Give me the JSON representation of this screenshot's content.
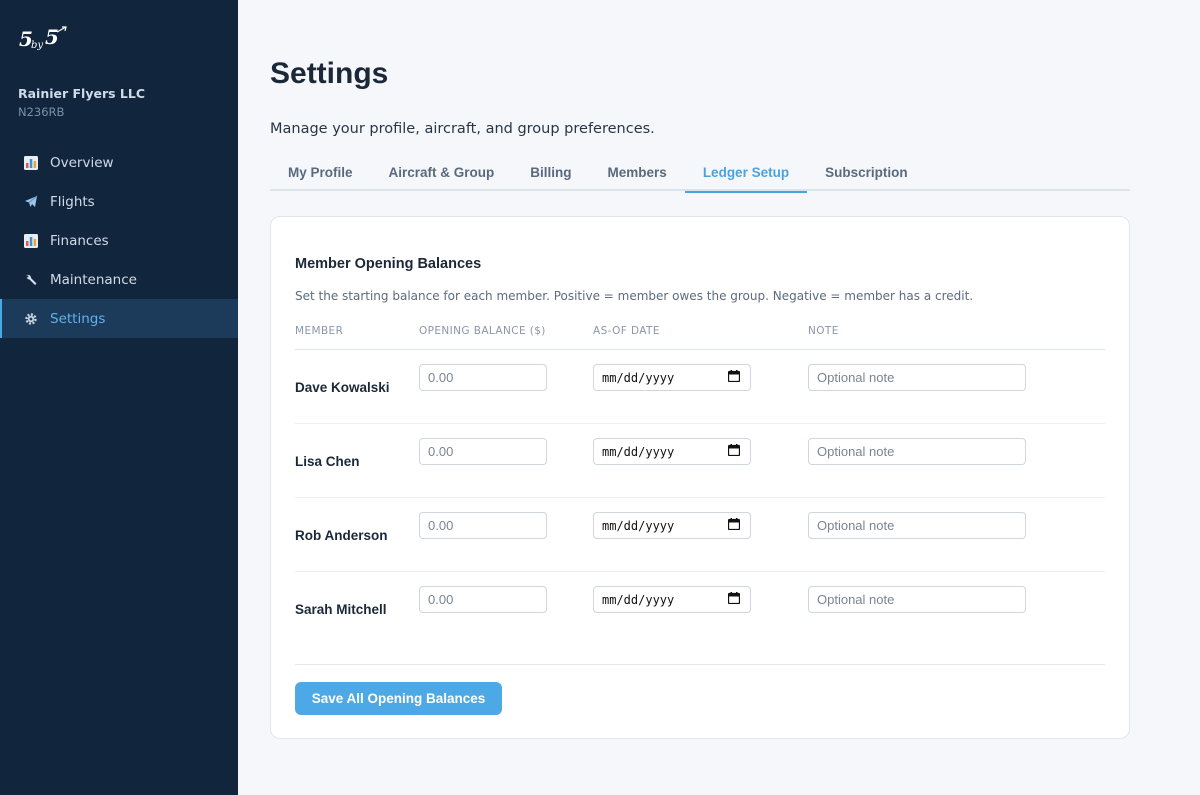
{
  "sidebar": {
    "logo_text": "5by5",
    "org_name": "Rainier Flyers LLC",
    "tail_number": "N236RB",
    "items": [
      {
        "label": "Overview",
        "icon": "bar-chart-icon"
      },
      {
        "label": "Flights",
        "icon": "airplane-icon"
      },
      {
        "label": "Finances",
        "icon": "bar-chart-icon"
      },
      {
        "label": "Maintenance",
        "icon": "wrench-icon"
      },
      {
        "label": "Settings",
        "icon": "gear-icon",
        "active": true
      }
    ]
  },
  "header": {
    "title": "Settings",
    "subtitle": "Manage your profile, aircraft, and group preferences."
  },
  "tabs": [
    {
      "label": "My Profile"
    },
    {
      "label": "Aircraft & Group"
    },
    {
      "label": "Billing"
    },
    {
      "label": "Members"
    },
    {
      "label": "Ledger Setup",
      "active": true
    },
    {
      "label": "Subscription"
    }
  ],
  "card": {
    "title": "Member Opening Balances",
    "description": "Set the starting balance for each member. Positive = member owes the group. Negative = member has a credit.",
    "columns": [
      "MEMBER",
      "OPENING BALANCE ($)",
      "AS-OF DATE",
      "NOTE"
    ],
    "rows": [
      {
        "member": "Dave Kowalski",
        "balance_placeholder": "0.00",
        "date_placeholder": "mm/dd/yyyy",
        "note_placeholder": "Optional note"
      },
      {
        "member": "Lisa Chen",
        "balance_placeholder": "0.00",
        "date_placeholder": "mm/dd/yyyy",
        "note_placeholder": "Optional note"
      },
      {
        "member": "Rob Anderson",
        "balance_placeholder": "0.00",
        "date_placeholder": "mm/dd/yyyy",
        "note_placeholder": "Optional note"
      },
      {
        "member": "Sarah Mitchell",
        "balance_placeholder": "0.00",
        "date_placeholder": "mm/dd/yyyy",
        "note_placeholder": "Optional note"
      }
    ],
    "save_label": "Save All Opening Balances"
  },
  "colors": {
    "sidebar_bg": "#11253d",
    "accent": "#4aa3df",
    "page_bg": "#f5f7fa"
  }
}
